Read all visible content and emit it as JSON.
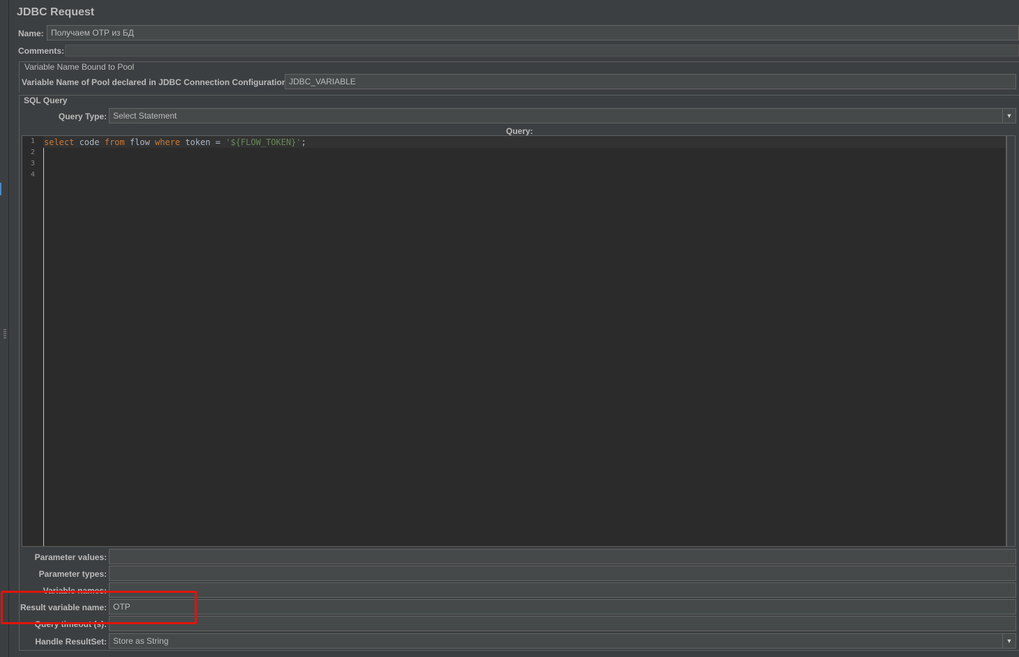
{
  "header": {
    "title": "JDBC Request"
  },
  "name_field": {
    "label": "Name:",
    "value": "Получаем ОТР из БД"
  },
  "comments": {
    "label": "Comments:"
  },
  "pool": {
    "group_title": "Variable Name Bound to Pool",
    "label": "Variable Name of Pool declared in JDBC Connection Configuration:",
    "value": "JDBC_VARIABLE"
  },
  "sql": {
    "group_title": "SQL Query",
    "query_type_label": "Query Type:",
    "query_type_value": "Select Statement",
    "query_label": "Query:",
    "line_numbers": [
      "1",
      "2",
      "3",
      "4"
    ],
    "code_tokens": {
      "kw1": "select",
      "t1": " code ",
      "kw2": "from",
      "t2": " flow ",
      "kw3": "where",
      "t3": " token = ",
      "str": "'${FLOW_TOKEN}'",
      "t4": ";"
    }
  },
  "params": {
    "parameter_values": {
      "label": "Parameter values:",
      "value": ""
    },
    "parameter_types": {
      "label": "Parameter types:",
      "value": ""
    },
    "variable_names": {
      "label": "Variable names:",
      "value": ""
    },
    "result_variable_name": {
      "label": "Result variable name:",
      "value": "OTP"
    },
    "query_timeout": {
      "label": "Query timeout (s):",
      "value": ""
    },
    "handle_resultset": {
      "label": "Handle ResultSet:",
      "value": "Store as String"
    }
  },
  "colors": {
    "highlight": "#e0140c",
    "keyword": "#cc7832",
    "string": "#6a8759"
  }
}
